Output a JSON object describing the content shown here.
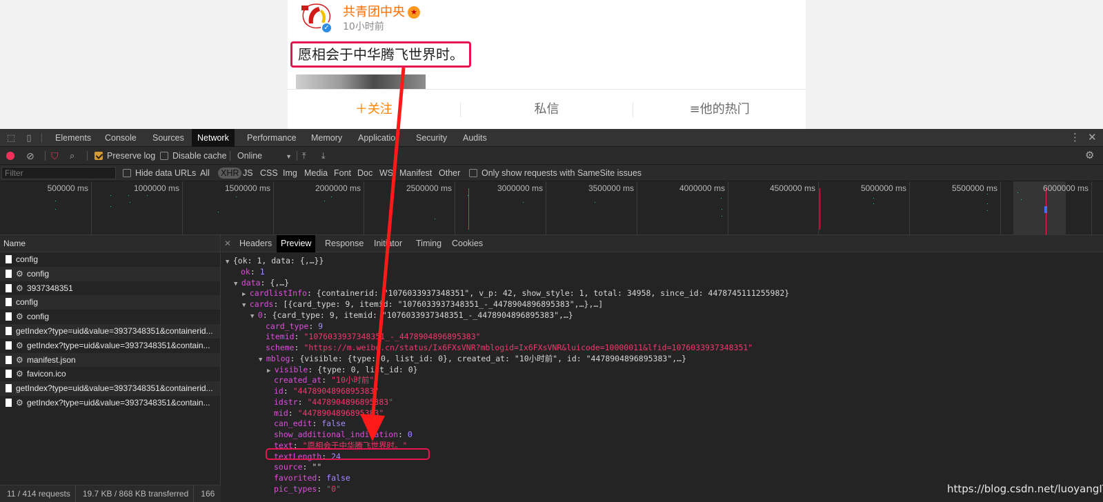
{
  "weibo": {
    "author": "共青团中央",
    "time": "10小时前",
    "post_text": "愿相会于中华腾飞世界时。",
    "actions": [
      "＋关注",
      "私信",
      "≡他的热门"
    ]
  },
  "devtools": {
    "tabs": [
      "Elements",
      "Console",
      "Sources",
      "Network",
      "Performance",
      "Memory",
      "Applicatio",
      "Security",
      "Audits"
    ],
    "active_tab": "Network",
    "toolbar": {
      "preserve_log": "Preserve log",
      "disable_cache": "Disable cache",
      "throttle": "Online"
    },
    "filter": {
      "placeholder": "Filter",
      "hide_data_urls": "Hide data URLs",
      "types": [
        "All",
        "XHR",
        "JS",
        "CSS",
        "Img",
        "Media",
        "Font",
        "Doc",
        "WS",
        "Manifest",
        "Other"
      ],
      "samesite": "Only show requests with SameSite issues"
    },
    "overview_ticks": [
      "500000 ms",
      "1000000 ms",
      "1500000 ms",
      "2000000 ms",
      "2500000 ms",
      "3000000 ms",
      "3500000 ms",
      "4000000 ms",
      "4500000 ms",
      "5000000 ms",
      "5500000 ms",
      "6000000 ms"
    ],
    "name_header": "Name",
    "requests": [
      {
        "name": "config",
        "gear": false
      },
      {
        "name": "config",
        "gear": true
      },
      {
        "name": "3937348351",
        "gear": true
      },
      {
        "name": "config",
        "gear": false
      },
      {
        "name": "config",
        "gear": true
      },
      {
        "name": "getIndex?type=uid&value=3937348351&containerid...",
        "gear": false
      },
      {
        "name": "getIndex?type=uid&value=3937348351&contain...",
        "gear": true
      },
      {
        "name": "manifest.json",
        "gear": true
      },
      {
        "name": "favicon.ico",
        "gear": true
      },
      {
        "name": "getIndex?type=uid&value=3937348351&containerid...",
        "gear": false
      },
      {
        "name": "getIndex?type=uid&value=3937348351&contain...",
        "gear": true
      }
    ],
    "status": {
      "requests": "11 / 414 requests",
      "transferred": "19.7 KB / 868 KB transferred",
      "extra": "166"
    },
    "detail_tabs": [
      "Headers",
      "Preview",
      "Response",
      "Initiator",
      "Timing",
      "Cookies"
    ],
    "active_detail_tab": "Preview",
    "preview": {
      "root": "{ok: 1, data: {,…}}",
      "ok": "1",
      "data": "{,…}",
      "cardlistInfo": "{containerid: \"1076033937348351\", v_p: 42, show_style: 1, total: 34958, since_id: 4478745111255982}",
      "cards": "[{card_type: 9, itemid: \"1076033937348351_-_4478904896895383\",…},…]",
      "card0": "{card_type: 9, itemid: \"1076033937348351_-_4478904896895383\",…}",
      "card_type": "9",
      "itemid": "\"1076033937348351_-_4478904896895383\"",
      "scheme": "\"https://m.weibo.cn/status/Ix6FXsVNR?mblogid=Ix6FXsVNR&luicode=10000011&lfid=1076033937348351\"",
      "mblog": "{visible: {type: 0, list_id: 0}, created_at: \"10小时前\", id: \"4478904896895383\",…}",
      "visible": "{type: 0, list_id: 0}",
      "created_at": "\"10小时前\"",
      "id": "\"4478904896895383\"",
      "idstr": "\"4478904896895383\"",
      "mid": "\"4478904896895383\"",
      "can_edit": "false",
      "show_additional_indication": "0",
      "text": "\"愿相会于中华腾飞世界时。\"",
      "textLength": "24",
      "source": "\"\"",
      "favorited": "false",
      "pic_types": "\"0\""
    }
  },
  "watermark": "https://blog.csdn.net/luoyangIT",
  "colors": {
    "accent_red": "#e6154f",
    "weibo_orange": "#ff8200",
    "devtools_bg": "#242424",
    "json_key": "#e14ce0",
    "json_string": "#f2386d"
  }
}
